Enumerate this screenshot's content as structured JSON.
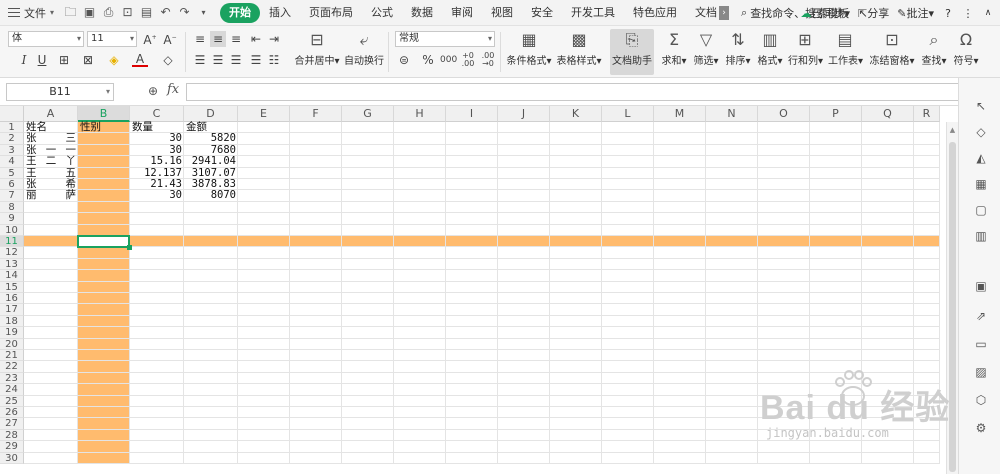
{
  "menubar": {
    "file": "文件",
    "tabs": [
      "开始",
      "插入",
      "页面布局",
      "公式",
      "数据",
      "审阅",
      "视图",
      "安全",
      "开发工具",
      "特色应用",
      "文档"
    ],
    "active_tab": "开始",
    "search_placeholder": "查找命令、搜索模板",
    "sync": "已同步",
    "share": "分享",
    "comment": "批注",
    "help": "?",
    "more": "⋮"
  },
  "ribbon": {
    "font_name": "体",
    "font_size": "11",
    "number_format": "常规",
    "buttons": {
      "merge": "合并居中",
      "wrap": "自动换行",
      "cond_format": "条件格式",
      "table_style": "表格样式",
      "doc_helper": "文档助手",
      "sum": "求和",
      "filter": "筛选",
      "sort": "排序",
      "format": "格式",
      "rowcol": "行和列",
      "sheet": "工作表",
      "freeze": "冻结窗格",
      "find": "查找",
      "symbol": "符号"
    }
  },
  "formula": {
    "cell_ref": "B11",
    "fx": "fx",
    "value": ""
  },
  "sheet": {
    "columns": [
      "A",
      "B",
      "C",
      "D",
      "E",
      "F",
      "G",
      "H",
      "I",
      "J",
      "K",
      "L",
      "M",
      "N",
      "O",
      "P",
      "Q",
      "R"
    ],
    "rows": [
      "1",
      "2",
      "3",
      "4",
      "5",
      "6",
      "7",
      "8",
      "9",
      "10",
      "11",
      "12",
      "13",
      "14",
      "15",
      "16",
      "17",
      "18",
      "19",
      "20",
      "21",
      "22",
      "23",
      "24",
      "25",
      "26",
      "27",
      "28",
      "29",
      "30"
    ],
    "selected_column": "B",
    "selected_row": "11",
    "headers": {
      "name": "姓名",
      "gender": "性别",
      "qty": "数量",
      "amount": "金额"
    },
    "data": [
      {
        "name": "张　　三",
        "gender": "",
        "qty": "30",
        "amount": "5820"
      },
      {
        "name": "张　一　一",
        "gender": "",
        "qty": "30",
        "amount": "7680"
      },
      {
        "name": "王　二　丫",
        "gender": "",
        "qty": "15.16",
        "amount": "2941.04"
      },
      {
        "name": "王　　五",
        "gender": "",
        "qty": "12.137",
        "amount": "3107.07"
      },
      {
        "name": "张　　希",
        "gender": "",
        "qty": "21.43",
        "amount": "3878.83"
      },
      {
        "name": "丽　　萨",
        "gender": "",
        "qty": "30",
        "amount": "8070"
      }
    ]
  },
  "colors": {
    "accent": "#1aa260",
    "highlight": "#ffbb6e"
  },
  "watermark": {
    "main": "Bai du 经验",
    "sub": "jingyan.baidu.com"
  }
}
